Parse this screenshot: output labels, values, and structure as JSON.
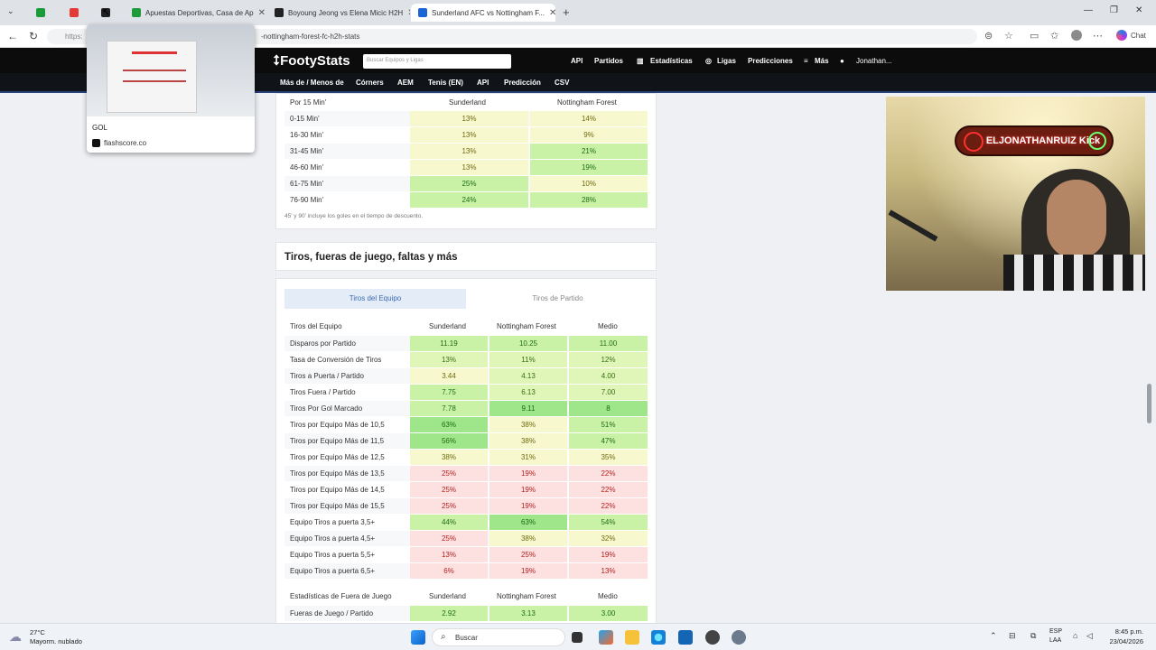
{
  "browser": {
    "tabs": [
      {
        "label": "Apuestas Deportivas, Casa de Ap"
      },
      {
        "label": "Boyoung Jeong vs Elena Micic H2H"
      },
      {
        "label": "Sunderland AFC vs Nottingham F..."
      }
    ],
    "url_prefix": "https:",
    "url_rest": "-nottingham-forest-fc-h2h-stats",
    "chat_label": "Chat",
    "popup": {
      "title": "GOL",
      "site": "flashscore.co"
    }
  },
  "site": {
    "logo": "FootyStats",
    "search_placeholder": "Buscar Equipos y Ligas",
    "menu": [
      "API",
      "Partidos",
      "Estadísticas",
      "Ligas",
      "Predicciones",
      "Más",
      "Jonathan..."
    ],
    "subnav": [
      "Más de / Menos de",
      "Córners",
      "AEM",
      "Tenis (EN)",
      "API",
      "Predicción",
      "CSV"
    ]
  },
  "goals_table": {
    "header": {
      "label": "Por 15 Min'",
      "team_a": "Sunderland",
      "team_b": "Nottingham Forest"
    },
    "rows": [
      {
        "label": "0-15 Min'",
        "a": "13%",
        "b": "14%"
      },
      {
        "label": "16-30 Min'",
        "a": "13%",
        "b": "9%"
      },
      {
        "label": "31-45 Min'",
        "a": "13%",
        "b": "21%"
      },
      {
        "label": "46-60 Min'",
        "a": "13%",
        "b": "19%"
      },
      {
        "label": "61-75 Min'",
        "a": "25%",
        "b": "10%"
      },
      {
        "label": "76-90 Min'",
        "a": "24%",
        "b": "28%"
      }
    ],
    "note": "45' y 90' incluye los goles en el tiempo de descuento."
  },
  "shots_section": {
    "title": "Tiros, fueras de juego, faltas y más",
    "tabs": [
      "Tiros del Equipo",
      "Tiros de Partido"
    ],
    "header": {
      "label": "Tiros del Equipo",
      "a": "Sunderland",
      "b": "Nottingham Forest",
      "c": "Medio"
    },
    "rows": [
      {
        "label": "Disparos por Partido",
        "a": "11.19",
        "b": "10.25",
        "c": "11.00"
      },
      {
        "label": "Tasa de Conversión de Tiros",
        "a": "13%",
        "b": "11%",
        "c": "12%"
      },
      {
        "label": "Tiros a Puerta / Partido",
        "a": "3.44",
        "b": "4.13",
        "c": "4.00"
      },
      {
        "label": "Tiros Fuera / Partido",
        "a": "7.75",
        "b": "6.13",
        "c": "7.00"
      },
      {
        "label": "Tiros Por Gol Marcado",
        "a": "7.78",
        "b": "9.11",
        "c": "8"
      },
      {
        "label": "Tiros por Equipo Más de 10,5",
        "a": "63%",
        "b": "38%",
        "c": "51%"
      },
      {
        "label": "Tiros por Equipo Más de 11,5",
        "a": "56%",
        "b": "38%",
        "c": "47%"
      },
      {
        "label": "Tiros por Equipo Más de 12,5",
        "a": "38%",
        "b": "31%",
        "c": "35%"
      },
      {
        "label": "Tiros por Equipo Más de 13,5",
        "a": "25%",
        "b": "19%",
        "c": "22%"
      },
      {
        "label": "Tiros por Equipo Más de 14,5",
        "a": "25%",
        "b": "19%",
        "c": "22%"
      },
      {
        "label": "Tiros por Equipo Más de 15,5",
        "a": "25%",
        "b": "19%",
        "c": "22%"
      },
      {
        "label": "Equipo Tiros a puerta 3,5+",
        "a": "44%",
        "b": "63%",
        "c": "54%"
      },
      {
        "label": "Equipo Tiros a puerta 4,5+",
        "a": "25%",
        "b": "38%",
        "c": "32%"
      },
      {
        "label": "Equipo Tiros a puerta 5,5+",
        "a": "13%",
        "b": "25%",
        "c": "19%"
      },
      {
        "label": "Equipo Tiros a puerta 6,5+",
        "a": "6%",
        "b": "19%",
        "c": "13%"
      }
    ],
    "offside_header": {
      "label": "Estadísticas de Fuera de Juego",
      "a": "Sunderland",
      "b": "Nottingham Forest",
      "c": "Medio"
    },
    "offside_rows": [
      {
        "label": "Fueras de Juego / Partido",
        "a": "2.92",
        "b": "3.13",
        "c": "3.00"
      }
    ]
  },
  "stream_overlay": {
    "name": "ELJONATHANRUIZ Kick"
  },
  "taskbar": {
    "weather_temp": "27°C",
    "weather_desc": "Mayorm. nublado",
    "search": "Buscar",
    "lang": "ESP",
    "region": "LAA",
    "time": "8:45 p.m.",
    "date": "23/04/2026"
  }
}
